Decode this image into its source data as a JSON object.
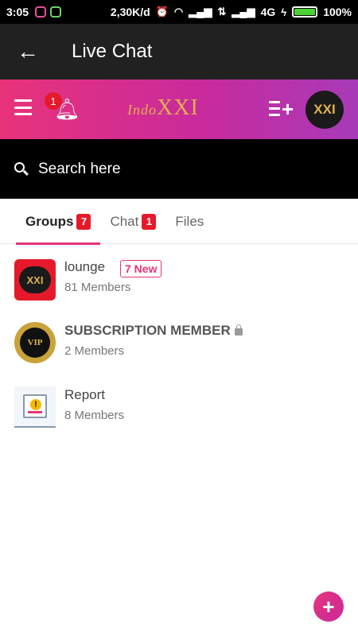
{
  "status_bar": {
    "time": "3:05",
    "network_speed": "2,30K/d",
    "network_type": "4G",
    "battery": "100%",
    "battery_level": 1.0
  },
  "app_bar": {
    "title": "Live Chat",
    "back_icon": "arrow-left-icon"
  },
  "brand_header": {
    "notification_count": "1",
    "logo_text": "IndoXXI",
    "avatar_text": "XXI",
    "colors": {
      "gradient_start": "#e8337a",
      "gradient_end": "#a83ab8"
    }
  },
  "search": {
    "placeholder": "Search here"
  },
  "tabs": [
    {
      "label": "Groups",
      "badge": "7",
      "active": true
    },
    {
      "label": "Chat",
      "badge": "1",
      "active": false
    },
    {
      "label": "Files",
      "badge": "",
      "active": false
    }
  ],
  "groups": [
    {
      "name": "lounge",
      "members": "81 Members",
      "new_badge": "7 New",
      "avatar_text": "XXI"
    },
    {
      "name": "SUBSCRIPTION MEMBER",
      "members": "2 Members",
      "locked": true,
      "avatar_text": "VIP"
    },
    {
      "name": "Report",
      "members": "8 Members",
      "avatar_text": "!"
    }
  ],
  "fab": {
    "label": "+"
  }
}
